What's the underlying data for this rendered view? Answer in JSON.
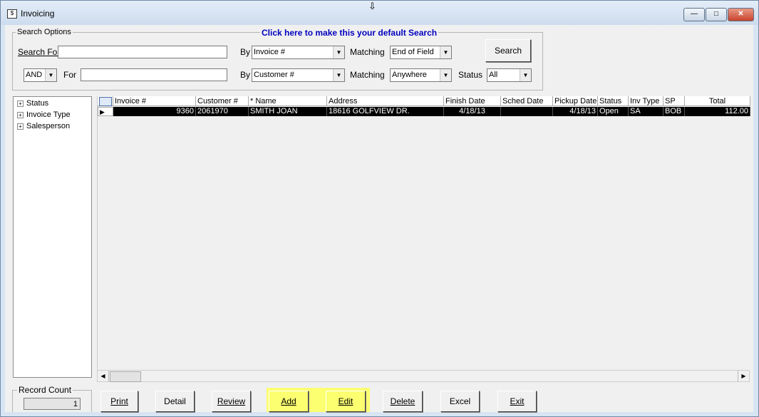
{
  "window": {
    "title": "Invoicing",
    "controls": {
      "minimize": "—",
      "maximize": "□",
      "close": "✕"
    }
  },
  "search": {
    "group_label": "Search Options",
    "default_link": "Click here to make this your default Search",
    "row1": {
      "label": "Search For",
      "value": "",
      "by_label": "By",
      "by_value": "Invoice #",
      "matching_label": "Matching",
      "matching_value": "End of Field"
    },
    "row2": {
      "logic_value": "AND",
      "for_label": "For",
      "value": "",
      "by_label": "By",
      "by_value": "Customer #",
      "matching_label": "Matching",
      "matching_value": "Anywhere",
      "status_label": "Status",
      "status_value": "All"
    },
    "button_label": "Search"
  },
  "tree": {
    "items": [
      {
        "label": "Status"
      },
      {
        "label": "Invoice Type"
      },
      {
        "label": "Salesperson"
      }
    ]
  },
  "grid": {
    "columns": [
      "Invoice #",
      "Customer #",
      "* Name",
      "Address",
      "Finish Date",
      "Sched Date",
      "Pickup Date",
      "Status",
      "Inv Type",
      "SP",
      "Total"
    ],
    "rows": [
      {
        "invoice": "9360",
        "customer": "2061970",
        "name": "SMITH JOAN",
        "address": "18616 GOLFVIEW DR.",
        "finish_date": "4/18/13",
        "sched_date": "",
        "pickup_date": "4/18/13",
        "status": "Open",
        "inv_type": "SA",
        "sp": "BOB",
        "total": "112.00"
      }
    ]
  },
  "record_count": {
    "label": "Record Count",
    "value": "1"
  },
  "buttons": {
    "print": "Print",
    "detail": "Detail",
    "review": "Review",
    "add": "Add",
    "edit": "Edit",
    "delete": "Delete",
    "excel": "Excel",
    "exit": "Exit"
  },
  "colors": {
    "highlight": "#fbff70",
    "link": "#0000c0",
    "selected_row": "#000000"
  },
  "icons": {
    "app": "invoice-app-icon",
    "pencil": "edit-pencil-icon",
    "row_pointer": "row-pointer-icon"
  }
}
